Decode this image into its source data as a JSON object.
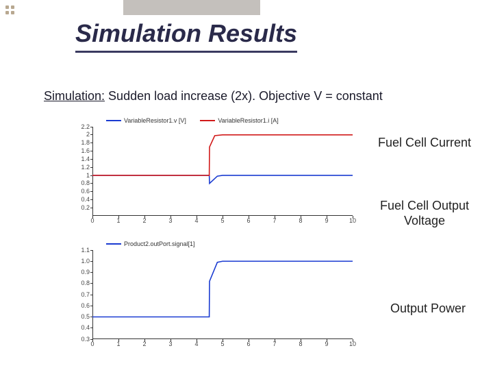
{
  "title": "Simulation Results",
  "subtitle_prefix": "Simulation:",
  "subtitle_rest": " Sudden load increase (2x). Objective V = constant",
  "annotations": {
    "current": "Fuel Cell Current",
    "voltage_l1": "Fuel Cell Output",
    "voltage_l2": "Voltage",
    "power": "Output Power"
  },
  "chart_data": [
    {
      "type": "line",
      "title": "",
      "xlabel": "",
      "ylabel": "",
      "xlim": [
        0,
        10
      ],
      "ylim": [
        0,
        2.2
      ],
      "xticks": [
        0,
        1,
        2,
        3,
        4,
        5,
        6,
        7,
        8,
        9,
        10
      ],
      "yticks": [
        0.2,
        0.4,
        0.6,
        0.8,
        1.0,
        1.2,
        1.4,
        1.6,
        1.8,
        2.0,
        2.2
      ],
      "legend": [
        {
          "name": "VariableResistor1.v [V]",
          "color": "#1a3bd1"
        },
        {
          "name": "VariableResistor1.i [A]",
          "color": "#d11a1a"
        }
      ],
      "series": [
        {
          "name": "voltage_V",
          "color": "#1a3bd1",
          "x": [
            0,
            4.49,
            4.5,
            4.8,
            5.0,
            10
          ],
          "y": [
            1.0,
            1.0,
            0.8,
            0.98,
            1.0,
            1.0
          ]
        },
        {
          "name": "current_A",
          "color": "#d11a1a",
          "x": [
            0,
            4.49,
            4.5,
            4.7,
            5.0,
            10
          ],
          "y": [
            1.0,
            1.0,
            1.7,
            1.98,
            2.0,
            2.0
          ]
        }
      ]
    },
    {
      "type": "line",
      "title": "",
      "xlabel": "",
      "ylabel": "",
      "xlim": [
        0,
        10
      ],
      "ylim": [
        0.3,
        1.1
      ],
      "xticks": [
        0,
        1,
        2,
        3,
        4,
        5,
        6,
        7,
        8,
        9,
        10
      ],
      "yticks": [
        0.3,
        0.4,
        0.5,
        0.6,
        0.7,
        0.8,
        0.9,
        1.0,
        1.1
      ],
      "legend": [
        {
          "name": "Product2.outPort.signal[1]",
          "color": "#1a3bd1"
        }
      ],
      "series": [
        {
          "name": "output_power",
          "color": "#1a3bd1",
          "x": [
            0,
            4.49,
            4.5,
            4.8,
            5.0,
            10
          ],
          "y": [
            0.5,
            0.5,
            0.82,
            0.99,
            1.0,
            1.0
          ]
        }
      ]
    }
  ]
}
